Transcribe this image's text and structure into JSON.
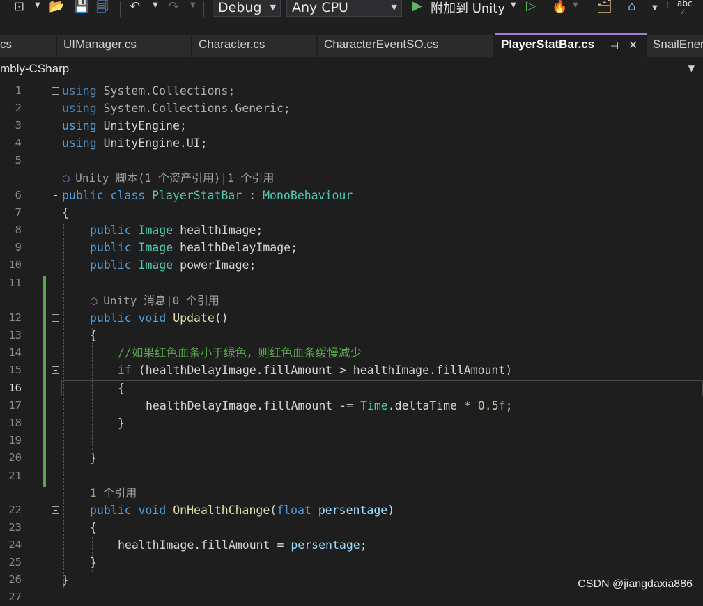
{
  "toolbar": {
    "config": "Debug",
    "platform": "Any CPU",
    "attach_label": "附加到 Unity",
    "spell_label": "abc"
  },
  "tabs": [
    {
      "label": "cs"
    },
    {
      "label": "UIManager.cs"
    },
    {
      "label": "Character.cs"
    },
    {
      "label": "CharacterEventSO.cs"
    },
    {
      "label": "PlayerStatBar.cs",
      "active": true
    },
    {
      "label": "SnailEner"
    }
  ],
  "tab_pin_icon": "⊣",
  "tab_close_icon": "✕",
  "nav": {
    "project": "mbly-CSharp"
  },
  "lines": {
    "l1": {
      "num": "1",
      "t1": "using",
      "t2": " System.Collections;"
    },
    "l2": {
      "num": "2",
      "t1": "using",
      "t2": " System.Collections.Generic;"
    },
    "l3": {
      "num": "3",
      "t1": "using",
      "t2": " UnityEngine;"
    },
    "l4": {
      "num": "4",
      "t1": "using",
      "t2": " UnityEngine.UI;"
    },
    "l5": {
      "num": "5"
    },
    "lens1": "Unity 脚本(1 个资产引用)|1 个引用",
    "l6": {
      "num": "6",
      "t1": "public class",
      "t2": "PlayerStatBar",
      "t3": " : ",
      "t4": "MonoBehaviour"
    },
    "l7": {
      "num": "7",
      "t1": "{"
    },
    "l8": {
      "num": "8",
      "t1": "public",
      "t2": "Image",
      "t3": " healthImage;"
    },
    "l9": {
      "num": "9",
      "t1": "public",
      "t2": "Image",
      "t3": " healthDelayImage;"
    },
    "l10": {
      "num": "10",
      "t1": "public",
      "t2": "Image",
      "t3": " powerImage;"
    },
    "l11": {
      "num": "11"
    },
    "lens2": "Unity 消息|0 个引用",
    "l12": {
      "num": "12",
      "t1": "public void",
      "t2": "Update",
      "t3": "()"
    },
    "l13": {
      "num": "13",
      "t1": "{"
    },
    "l14": {
      "num": "14",
      "t1": "//如果红色血条小于绿色，则红色血条缓慢减少"
    },
    "l15": {
      "num": "15",
      "t1": "if",
      "t2": " (healthDelayImage.fillAmount > healthImage.fillAmount)"
    },
    "l16": {
      "num": "16",
      "t1": "{"
    },
    "l17": {
      "num": "17",
      "t1": "healthDelayImage.fillAmount -= ",
      "t2": "Time",
      "t3": ".deltaTime * ",
      "t4": "0.5f",
      "t5": ";"
    },
    "l18": {
      "num": "18",
      "t1": "}"
    },
    "l19": {
      "num": "19"
    },
    "l20": {
      "num": "20",
      "t1": "}"
    },
    "l21": {
      "num": "21"
    },
    "lens3": "1 个引用",
    "l22": {
      "num": "22",
      "t1": "public void",
      "t2": "OnHealthChange",
      "t3": "(",
      "t4": "float",
      "t5": "persentage",
      "t6": ")"
    },
    "l23": {
      "num": "23",
      "t1": "{"
    },
    "l24": {
      "num": "24",
      "t1": "healthImage.fillAmount = ",
      "t2": "persentage",
      "t3": ";"
    },
    "l25": {
      "num": "25",
      "t1": "}"
    },
    "l26": {
      "num": "26",
      "t1": "}"
    },
    "l27": {
      "num": "27"
    }
  },
  "watermark": "CSDN @jiangdaxia886"
}
